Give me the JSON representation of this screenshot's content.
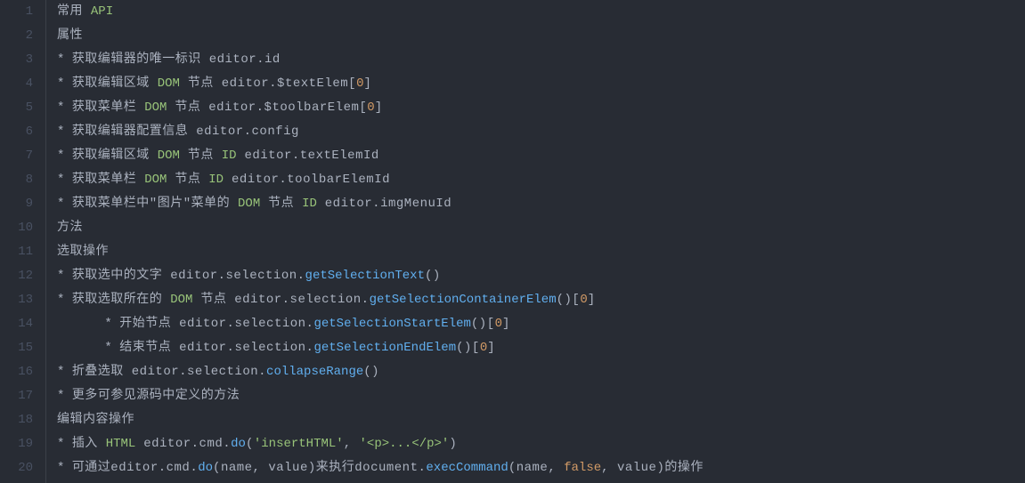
{
  "lines": [
    [
      {
        "cls": "tok-text",
        "text": "常用 "
      },
      {
        "cls": "tok-keyword",
        "text": "API"
      }
    ],
    [
      {
        "cls": "tok-text",
        "text": "属性"
      }
    ],
    [
      {
        "cls": "tok-star",
        "text": "* "
      },
      {
        "cls": "tok-text",
        "text": "获取编辑器的唯一标识 editor.id"
      }
    ],
    [
      {
        "cls": "tok-star",
        "text": "* "
      },
      {
        "cls": "tok-text",
        "text": "获取编辑区域 "
      },
      {
        "cls": "tok-keyword",
        "text": "DOM"
      },
      {
        "cls": "tok-text",
        "text": " 节点 editor.$textElem["
      },
      {
        "cls": "tok-number",
        "text": "0"
      },
      {
        "cls": "tok-text",
        "text": "]"
      }
    ],
    [
      {
        "cls": "tok-star",
        "text": "* "
      },
      {
        "cls": "tok-text",
        "text": "获取菜单栏 "
      },
      {
        "cls": "tok-keyword",
        "text": "DOM"
      },
      {
        "cls": "tok-text",
        "text": " 节点 editor.$toolbarElem["
      },
      {
        "cls": "tok-number",
        "text": "0"
      },
      {
        "cls": "tok-text",
        "text": "]"
      }
    ],
    [
      {
        "cls": "tok-star",
        "text": "* "
      },
      {
        "cls": "tok-text",
        "text": "获取编辑器配置信息 editor.config"
      }
    ],
    [
      {
        "cls": "tok-star",
        "text": "* "
      },
      {
        "cls": "tok-text",
        "text": "获取编辑区域 "
      },
      {
        "cls": "tok-keyword",
        "text": "DOM"
      },
      {
        "cls": "tok-text",
        "text": " 节点 "
      },
      {
        "cls": "tok-keyword",
        "text": "ID"
      },
      {
        "cls": "tok-text",
        "text": " editor.textElemId"
      }
    ],
    [
      {
        "cls": "tok-star",
        "text": "* "
      },
      {
        "cls": "tok-text",
        "text": "获取菜单栏 "
      },
      {
        "cls": "tok-keyword",
        "text": "DOM"
      },
      {
        "cls": "tok-text",
        "text": " 节点 "
      },
      {
        "cls": "tok-keyword",
        "text": "ID"
      },
      {
        "cls": "tok-text",
        "text": " editor.toolbarElemId"
      }
    ],
    [
      {
        "cls": "tok-star",
        "text": "* "
      },
      {
        "cls": "tok-text",
        "text": "获取菜单栏中\"图片\"菜单的 "
      },
      {
        "cls": "tok-keyword",
        "text": "DOM"
      },
      {
        "cls": "tok-text",
        "text": " 节点 "
      },
      {
        "cls": "tok-keyword",
        "text": "ID"
      },
      {
        "cls": "tok-text",
        "text": " editor.imgMenuId"
      }
    ],
    [
      {
        "cls": "tok-text",
        "text": "方法"
      }
    ],
    [
      {
        "cls": "tok-text",
        "text": "选取操作"
      }
    ],
    [
      {
        "cls": "tok-star",
        "text": "* "
      },
      {
        "cls": "tok-text",
        "text": "获取选中的文字 editor.selection."
      },
      {
        "cls": "tok-method",
        "text": "getSelectionText"
      },
      {
        "cls": "tok-text",
        "text": "()"
      }
    ],
    [
      {
        "cls": "tok-star",
        "text": "* "
      },
      {
        "cls": "tok-text",
        "text": "获取选取所在的 "
      },
      {
        "cls": "tok-keyword",
        "text": "DOM"
      },
      {
        "cls": "tok-text",
        "text": " 节点 editor.selection."
      },
      {
        "cls": "tok-method",
        "text": "getSelectionContainerElem"
      },
      {
        "cls": "tok-text",
        "text": "()["
      },
      {
        "cls": "tok-number",
        "text": "0"
      },
      {
        "cls": "tok-text",
        "text": "]"
      }
    ],
    [
      {
        "cls": "tok-text",
        "text": "      "
      },
      {
        "cls": "tok-star",
        "text": "* "
      },
      {
        "cls": "tok-text",
        "text": "开始节点 editor.selection."
      },
      {
        "cls": "tok-method",
        "text": "getSelectionStartElem"
      },
      {
        "cls": "tok-text",
        "text": "()["
      },
      {
        "cls": "tok-number",
        "text": "0"
      },
      {
        "cls": "tok-text",
        "text": "]"
      }
    ],
    [
      {
        "cls": "tok-text",
        "text": "      "
      },
      {
        "cls": "tok-star",
        "text": "* "
      },
      {
        "cls": "tok-text",
        "text": "结束节点 editor.selection."
      },
      {
        "cls": "tok-method",
        "text": "getSelectionEndElem"
      },
      {
        "cls": "tok-text",
        "text": "()["
      },
      {
        "cls": "tok-number",
        "text": "0"
      },
      {
        "cls": "tok-text",
        "text": "]"
      }
    ],
    [
      {
        "cls": "tok-star",
        "text": "* "
      },
      {
        "cls": "tok-text",
        "text": "折叠选取 editor.selection."
      },
      {
        "cls": "tok-method",
        "text": "collapseRange"
      },
      {
        "cls": "tok-text",
        "text": "()"
      }
    ],
    [
      {
        "cls": "tok-star",
        "text": "* "
      },
      {
        "cls": "tok-text",
        "text": "更多可参见源码中定义的方法"
      }
    ],
    [
      {
        "cls": "tok-text",
        "text": "编辑内容操作"
      }
    ],
    [
      {
        "cls": "tok-star",
        "text": "* "
      },
      {
        "cls": "tok-text",
        "text": "插入 "
      },
      {
        "cls": "tok-keyword",
        "text": "HTML"
      },
      {
        "cls": "tok-text",
        "text": " editor.cmd."
      },
      {
        "cls": "tok-method",
        "text": "do"
      },
      {
        "cls": "tok-text",
        "text": "("
      },
      {
        "cls": "tok-str",
        "text": "'insertHTML'"
      },
      {
        "cls": "tok-text",
        "text": ", "
      },
      {
        "cls": "tok-str",
        "text": "'<p>...</p>'"
      },
      {
        "cls": "tok-text",
        "text": ")"
      }
    ],
    [
      {
        "cls": "tok-star",
        "text": "* "
      },
      {
        "cls": "tok-text",
        "text": "可通过editor.cmd."
      },
      {
        "cls": "tok-method",
        "text": "do"
      },
      {
        "cls": "tok-text",
        "text": "(name, value)来执行document."
      },
      {
        "cls": "tok-method",
        "text": "execCommand"
      },
      {
        "cls": "tok-text",
        "text": "(name, "
      },
      {
        "cls": "tok-bool",
        "text": "false"
      },
      {
        "cls": "tok-text",
        "text": ", value)的操作"
      }
    ]
  ]
}
